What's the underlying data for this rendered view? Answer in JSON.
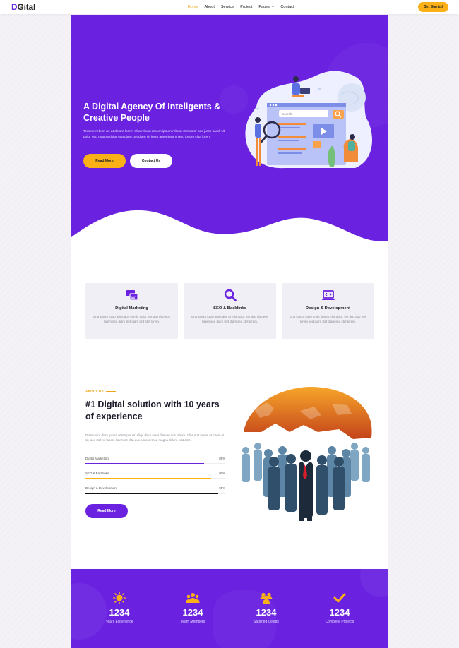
{
  "brand": {
    "logo_prefix": "D",
    "logo_suffix": "Gital"
  },
  "nav": {
    "items": [
      {
        "label": "Home",
        "active": true
      },
      {
        "label": "About",
        "active": false
      },
      {
        "label": "Service",
        "active": false
      },
      {
        "label": "Project",
        "active": false
      },
      {
        "label": "Pages",
        "active": false,
        "dropdown": true
      },
      {
        "label": "Contact",
        "active": false
      }
    ],
    "cta_label": "Get Started"
  },
  "hero": {
    "title": "A Digital Agency Of Inteligents & Creative People",
    "text": "Tempor rebum no at dolore lorem clita rebum rebum ipsum rebum stet dolor sed justo kasd. Ut dolor sed magna dolor sea diam. Sit diam sit justo amet ipsum vero ipsum clita lorem",
    "primary_button": "Read More",
    "secondary_button": "Contact Us",
    "search_placeholder": "Search..."
  },
  "services": [
    {
      "title": "Digital Marketing",
      "icon": "marketing-icon",
      "desc": "Erat ipsum justo amet duo et elitr dolor, est duo duo eos lorem sed diam stet diam sed stet lorem."
    },
    {
      "title": "SEO & Backlinks",
      "icon": "search-icon",
      "desc": "Erat ipsum justo amet duo et elitr dolor, est duo duo eos lorem sed diam stet diam sed stet lorem."
    },
    {
      "title": "Design & Development",
      "icon": "laptop-code-icon",
      "desc": "Erat ipsum justo amet duo et elitr dolor, est duo duo eos lorem sed diam stet diam sed stet lorem."
    }
  ],
  "about": {
    "label": "ABOUT US",
    "title": "#1 Digital solution with 10 years of experience",
    "text": "Diam dolor diam ipsum et tempor sit. Aliqu diam amet diam et eos labore. Clita erat ipsum et lorem et sit, sed stet no labore lorem sit clita duo justo eirmod magna dolore erat amet",
    "skills": [
      {
        "name": "Digital Marketing",
        "percent_label": "85%",
        "value": 0.85,
        "color": "#6a22e0"
      },
      {
        "name": "SEO & Backlinks",
        "percent_label": "90%",
        "value": 0.9,
        "color": "#fbb018"
      },
      {
        "name": "Design & Development",
        "percent_label": "95%",
        "value": 0.95,
        "color": "#111111"
      }
    ],
    "button": "Read More"
  },
  "stats": [
    {
      "number": "1234",
      "label": "Years Experience",
      "icon": "sun-icon"
    },
    {
      "number": "1234",
      "label": "Team Members",
      "icon": "team-icon"
    },
    {
      "number": "1234",
      "label": "Satisfied Clients",
      "icon": "clients-icon"
    },
    {
      "number": "1234",
      "label": "Complete Projects",
      "icon": "check-icon"
    }
  ],
  "colors": {
    "primary": "#6a22e0",
    "accent": "#fbb018",
    "dark": "#1b1b2b"
  }
}
